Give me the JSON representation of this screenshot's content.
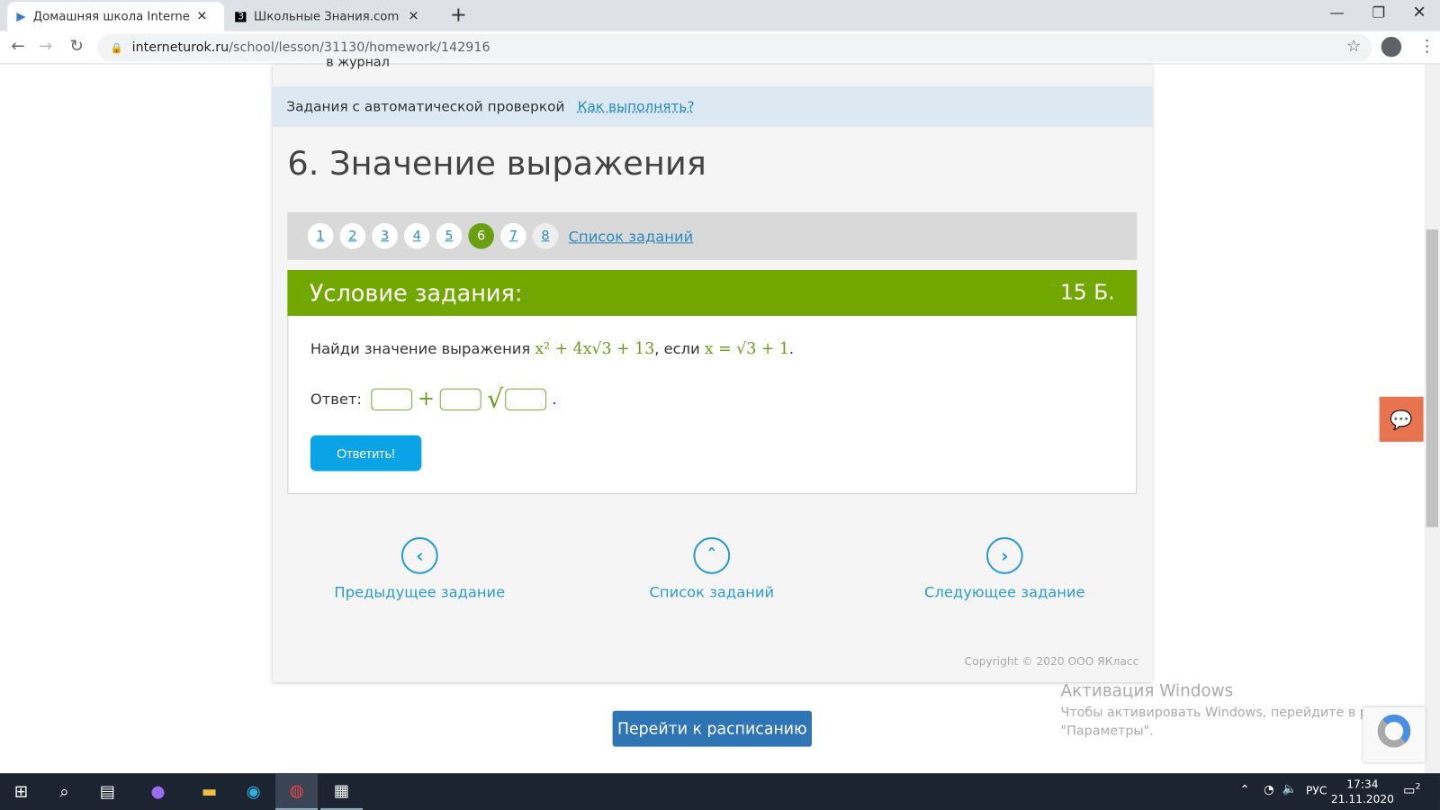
{
  "browser": {
    "tabs": [
      {
        "title": "Домашняя школа InternetUrok.ru",
        "active": true
      },
      {
        "title": "Школьные Знания.com - Решаем",
        "active": false
      }
    ],
    "url_host": "interneturok.ru",
    "url_path": "/school/lesson/31130/homework/142916"
  },
  "page": {
    "top_text": "в журнал",
    "info_label": "Задания с автоматической проверкой",
    "info_link": "Как выполнять?",
    "title": "6. Значение выражения",
    "task_numbers": [
      "1",
      "2",
      "3",
      "4",
      "5",
      "6",
      "7",
      "8"
    ],
    "current_task": "6",
    "task_list_link": "Список заданий",
    "condition_header": "Условие задания:",
    "points": "15 Б.",
    "question_text": "Найди значение выражения",
    "expression": "x² + 4x√3 + 13",
    "if_text": ", если",
    "condition_expr": "x = √3 + 1",
    "period": ".",
    "answer_label": "Ответ:",
    "plus": "+",
    "sqrt": "√",
    "answer_inputs": [
      "",
      "",
      ""
    ],
    "submit": "Ответить!",
    "nav": {
      "prev": "Предыдущее задание",
      "list": "Список заданий",
      "next": "Следующее задание"
    },
    "copyright": "Copyright © 2020 ООО ЯКласс",
    "schedule_button": "Перейти к расписанию"
  },
  "watermark": {
    "title": "Активация Windows",
    "line1": "Чтобы активировать Windows, перейдите в раздел",
    "line2": "\"Параметры\"."
  },
  "taskbar": {
    "lang": "РУС",
    "time": "17:34",
    "date": "21.11.2020",
    "notifications": "2"
  }
}
